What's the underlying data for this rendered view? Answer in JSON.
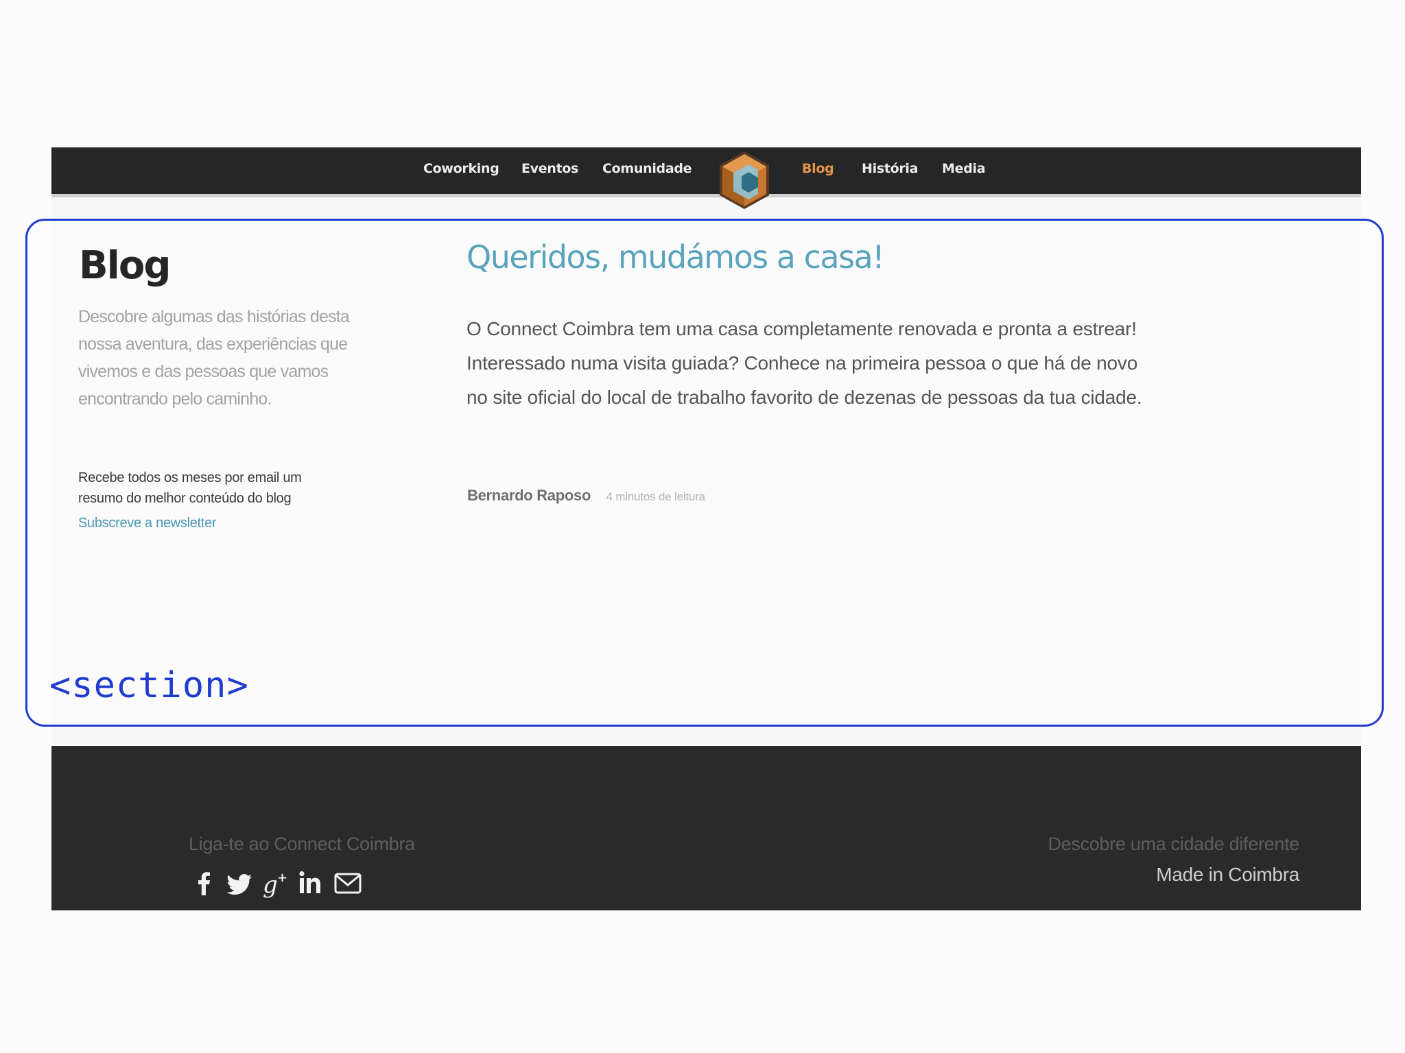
{
  "nav": {
    "items_left": [
      {
        "label": "Coworking"
      },
      {
        "label": "Eventos"
      },
      {
        "label": "Comunidade"
      }
    ],
    "items_right": [
      {
        "label": "Blog",
        "active": true
      },
      {
        "label": "História"
      },
      {
        "label": "Media"
      }
    ],
    "active_color": "#e8954a",
    "logo_icon": "connect-coimbra-hexagon-logo"
  },
  "section_label": "<section>",
  "sidebar": {
    "title": "Blog",
    "description": "Descobre algumas das histórias desta nossa aventura, das experiências que vivemos e das pessoas que vamos encontrando pelo caminho.",
    "newsletter_text": "Recebe todos os meses por email um resumo do melhor conteúdo do blog",
    "newsletter_link": "Subscreve a newsletter"
  },
  "post": {
    "title": "Queridos, mudámos a casa!",
    "excerpt": "O Connect Coimbra tem uma casa completamente renovada e pronta a estrear! Interessado numa visita guiada? Conhece na primeira pessoa o que há de novo no site oficial do local de trabalho favorito de dezenas de pessoas da tua cidade.",
    "author": "Bernardo Raposo",
    "read_time": "4 minutos de leitura"
  },
  "footer": {
    "connect_text": "Liga-te ao Connect Coimbra",
    "social_icons": [
      "facebook-icon",
      "twitter-icon",
      "google-plus-icon",
      "linkedin-icon",
      "email-icon"
    ],
    "discover_text": "Descobre uma cidade diferente",
    "made_text": "Made in Coimbra"
  },
  "colors": {
    "nav_background": "#262626",
    "link": "#4a98b8",
    "section_outline": "#1f3ccf"
  }
}
